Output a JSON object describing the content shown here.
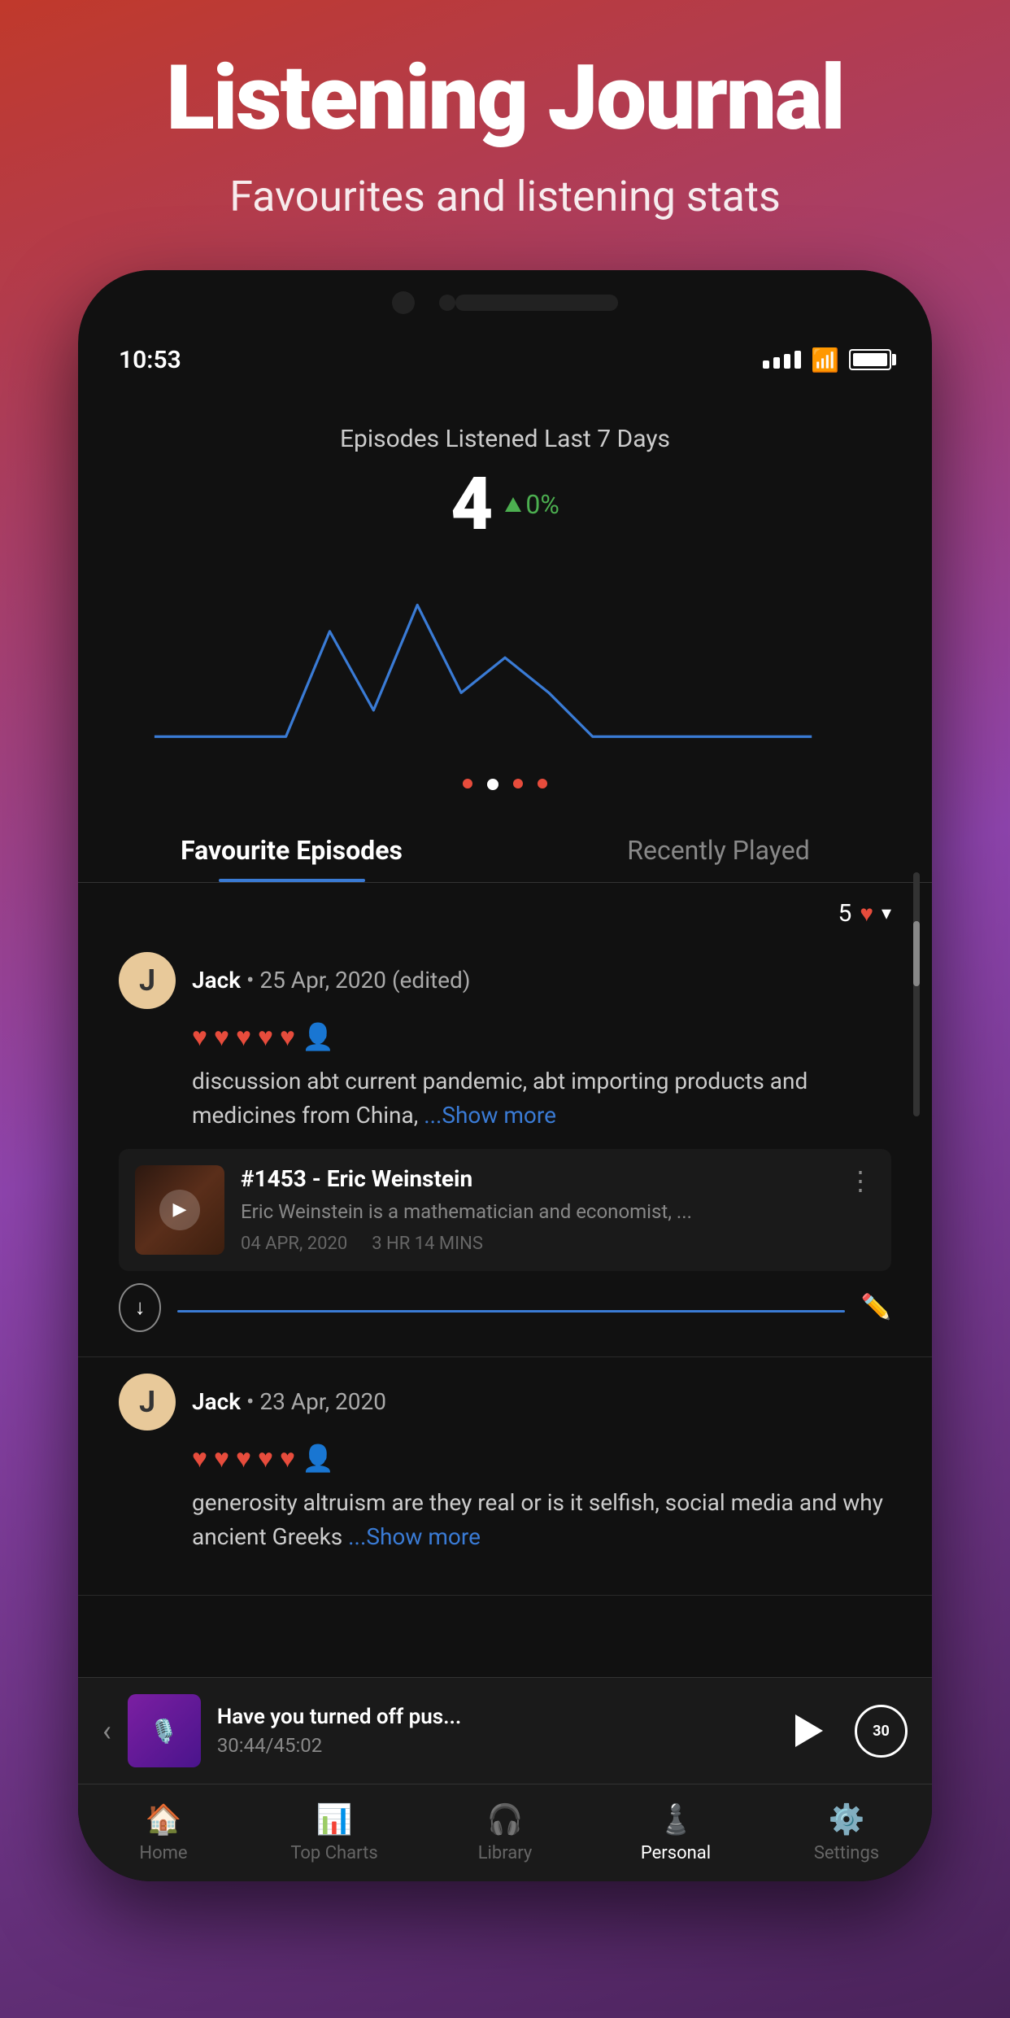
{
  "header": {
    "title": "Listening Journal",
    "subtitle": "Favourites and listening stats"
  },
  "statusBar": {
    "time": "10:53",
    "battery": "full"
  },
  "stats": {
    "label": "Episodes Listened Last 7 Days",
    "count": "4",
    "change": "0%",
    "changeDirection": "up"
  },
  "tabs": [
    {
      "label": "Favourite Episodes",
      "active": true
    },
    {
      "label": "Recently Played",
      "active": false
    }
  ],
  "filter": {
    "count": "5"
  },
  "episodes": [
    {
      "author": "Jack",
      "date": "25 Apr, 2020",
      "edited": true,
      "hearts": 5,
      "note": "discussion abt current pandemic, abt importing products and medicines from China, ",
      "showMore": "...Show more",
      "podcast": {
        "title": "#1453 - Eric Weinstein",
        "description": "Eric Weinstein is a mathematician and economist, ...",
        "date": "04 APR, 2020",
        "duration": "3 HR 14 MINS"
      }
    },
    {
      "author": "Jack",
      "date": "23 Apr, 2020",
      "edited": false,
      "hearts": 5,
      "note": "generosity altruism are they real or is it selfish, social media and why ancient Greeks",
      "showMore": "...Show more"
    }
  ],
  "player": {
    "title": "Have you turned off pus...",
    "time": "30:44/45:02"
  },
  "bottomNav": [
    {
      "label": "Home",
      "icon": "🏠",
      "active": false
    },
    {
      "label": "Top Charts",
      "icon": "📊",
      "active": false
    },
    {
      "label": "Library",
      "icon": "🎧",
      "active": false
    },
    {
      "label": "Personal",
      "icon": "👤",
      "active": true
    },
    {
      "label": "Settings",
      "icon": "⚙️",
      "active": false
    }
  ],
  "icons": {
    "play": "▶",
    "download": "↓",
    "edit": "✏️",
    "dots": "⋮",
    "heart": "♥",
    "user": "👤",
    "chevronDown": "▾",
    "back": "‹",
    "skip30": "30"
  }
}
